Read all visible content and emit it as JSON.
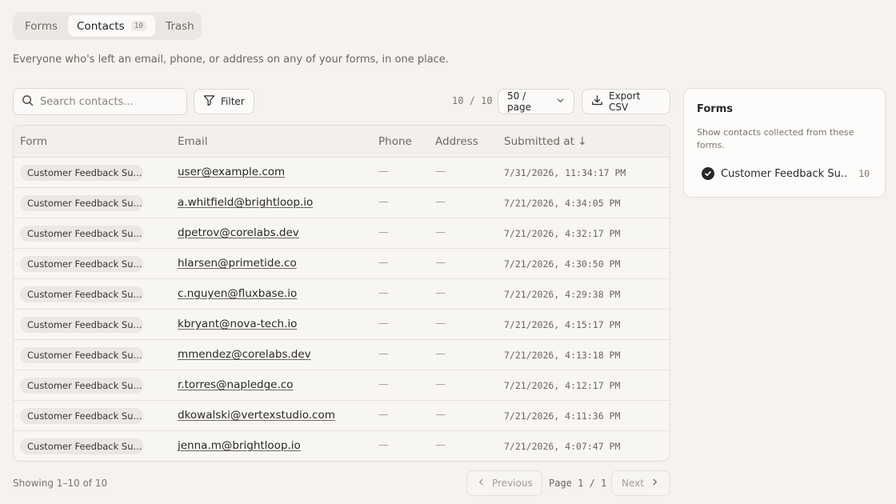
{
  "tabs": [
    {
      "label": "Forms",
      "active": false
    },
    {
      "label": "Contacts",
      "active": true,
      "count": "10"
    },
    {
      "label": "Trash",
      "active": false
    }
  ],
  "description": "Everyone who's left an email, phone, or address on any of your forms, in one place.",
  "toolbar": {
    "search_placeholder": "Search contacts...",
    "search_value": "",
    "filter_label": "Filter",
    "count_readout": "10 / 10",
    "per_page_label": "50 / page",
    "export_label": "Export CSV"
  },
  "table": {
    "headers": {
      "form": "Form",
      "email": "Email",
      "phone": "Phone",
      "address": "Address",
      "submitted": "Submitted at ↓"
    },
    "rows": [
      {
        "form": "Customer Feedback Su...",
        "email": "user@example.com",
        "phone": "—",
        "address": "—",
        "submitted": "7/31/2026, 11:34:17 PM"
      },
      {
        "form": "Customer Feedback Su...",
        "email": "a.whitfield@brightloop.io",
        "phone": "—",
        "address": "—",
        "submitted": "7/21/2026, 4:34:05 PM"
      },
      {
        "form": "Customer Feedback Su...",
        "email": "dpetrov@corelabs.dev",
        "phone": "—",
        "address": "—",
        "submitted": "7/21/2026, 4:32:17 PM"
      },
      {
        "form": "Customer Feedback Su...",
        "email": "hlarsen@primetide.co",
        "phone": "—",
        "address": "—",
        "submitted": "7/21/2026, 4:30:50 PM"
      },
      {
        "form": "Customer Feedback Su...",
        "email": "c.nguyen@fluxbase.io",
        "phone": "—",
        "address": "—",
        "submitted": "7/21/2026, 4:29:38 PM"
      },
      {
        "form": "Customer Feedback Su...",
        "email": "kbryant@nova-tech.io",
        "phone": "—",
        "address": "—",
        "submitted": "7/21/2026, 4:15:17 PM"
      },
      {
        "form": "Customer Feedback Su...",
        "email": "mmendez@corelabs.dev",
        "phone": "—",
        "address": "—",
        "submitted": "7/21/2026, 4:13:18 PM"
      },
      {
        "form": "Customer Feedback Su...",
        "email": "r.torres@napledge.co",
        "phone": "—",
        "address": "—",
        "submitted": "7/21/2026, 4:12:17 PM"
      },
      {
        "form": "Customer Feedback Su...",
        "email": "dkowalski@vertexstudio.com",
        "phone": "—",
        "address": "—",
        "submitted": "7/21/2026, 4:11:36 PM"
      },
      {
        "form": "Customer Feedback Su...",
        "email": "jenna.m@brightloop.io",
        "phone": "—",
        "address": "—",
        "submitted": "7/21/2026, 4:07:47 PM"
      }
    ]
  },
  "footer": {
    "showing": "Showing 1–10 of 10",
    "prev_label": "Previous",
    "page_readout": "Page 1 / 1",
    "next_label": "Next"
  },
  "panel": {
    "title": "Forms",
    "description": "Show contacts collected from these forms.",
    "items": [
      {
        "label": "Customer Feedback Su...",
        "count": "10",
        "checked": true
      }
    ]
  },
  "icons": {
    "search": "search-icon",
    "filter": "filter-icon",
    "chevron_down": "chevron-down-icon",
    "download": "download-icon",
    "chevron_left": "chevron-left-icon",
    "chevron_right": "chevron-right-icon",
    "check": "check-circle-icon"
  },
  "colors": {
    "background": "#f6f3ef",
    "text": "#2a2826",
    "muted": "#7a756e",
    "border": "#dcd7d0"
  }
}
